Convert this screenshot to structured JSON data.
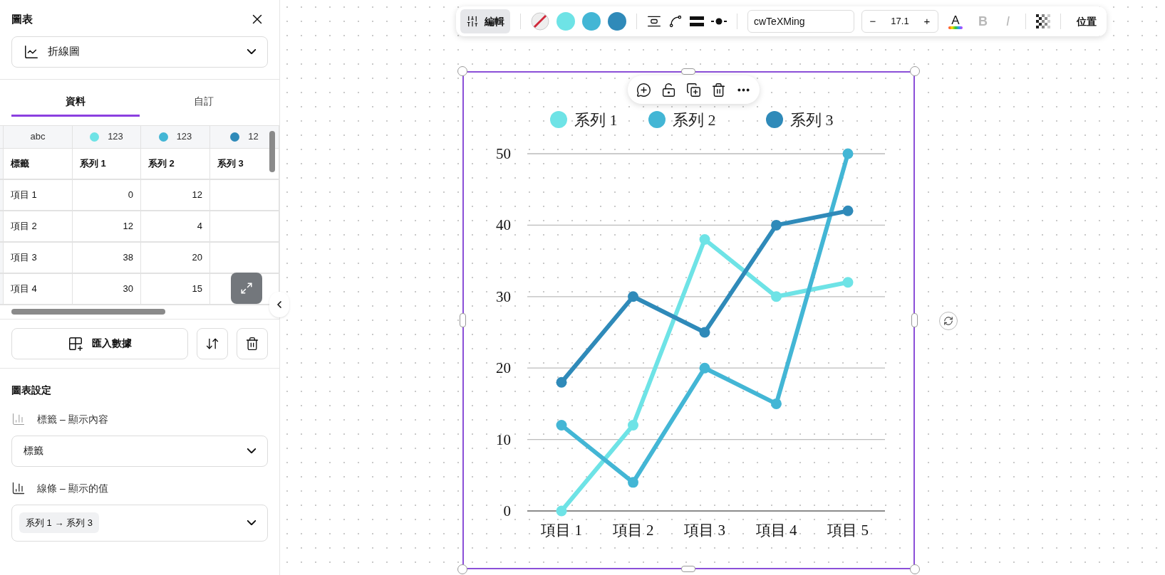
{
  "panel": {
    "title": "圖表",
    "chart_type": "折線圖",
    "tabs": [
      {
        "label": "資料",
        "selected": true
      },
      {
        "label": "自訂",
        "selected": false
      }
    ],
    "table": {
      "type_row": [
        {
          "kind": "text",
          "label": "abc"
        },
        {
          "kind": "number",
          "label": "123",
          "color": "#6ee3e6"
        },
        {
          "kind": "number",
          "label": "123",
          "color": "#43b6d5"
        },
        {
          "kind": "number",
          "label": "12",
          "color": "#2f8ab9"
        }
      ],
      "columns": [
        "標籤",
        "系列 1",
        "系列 2",
        "系列 3"
      ],
      "rows": [
        {
          "cells": [
            "項目 1",
            "0",
            "12"
          ]
        },
        {
          "cells": [
            "項目 2",
            "12",
            "4"
          ]
        },
        {
          "cells": [
            "項目 3",
            "38",
            "20"
          ]
        },
        {
          "cells": [
            "項目 4",
            "30",
            "15"
          ]
        }
      ]
    },
    "import_button": "匯入數據",
    "settings": {
      "title": "圖表設定",
      "label_field": {
        "label": "標籤 – 顯示內容",
        "value": "標籤"
      },
      "line_field": {
        "label": "線條 – 顯示的值",
        "chip": "系列 1 → 系列 3"
      }
    }
  },
  "toolbar": {
    "edit": "編輯",
    "swatches": [
      {
        "color": "#6ee3e6"
      },
      {
        "color": "#43b6d5"
      },
      {
        "color": "#2f8ab9"
      }
    ],
    "font": "cwTeXMing",
    "size": {
      "minus": "−",
      "value": "17.1",
      "plus": "+"
    },
    "color_letter": "A",
    "bold": {
      "label": "B",
      "disabled": true
    },
    "italic": {
      "label": "I",
      "disabled": true
    },
    "position": "位置"
  },
  "chart": {
    "chart_data": {
      "type": "line",
      "categories": [
        "項目 1",
        "項目 2",
        "項目 3",
        "項目 4",
        "項目 5"
      ],
      "series": [
        {
          "name": "系列 1",
          "color": "#6ee3e6",
          "marker": "circle",
          "values": [
            0,
            12,
            38,
            30,
            32
          ]
        },
        {
          "name": "系列 2",
          "color": "#43b6d5",
          "marker": "circle",
          "values": [
            12,
            4,
            20,
            15,
            50
          ]
        },
        {
          "name": "系列 3",
          "color": "#2f8ab9",
          "marker": "circle",
          "values": [
            18,
            30,
            25,
            40,
            42
          ]
        }
      ],
      "ylim": [
        0,
        50
      ],
      "yticks": [
        0,
        10,
        20,
        30,
        40,
        50
      ],
      "grid": true,
      "legend": true
    }
  }
}
